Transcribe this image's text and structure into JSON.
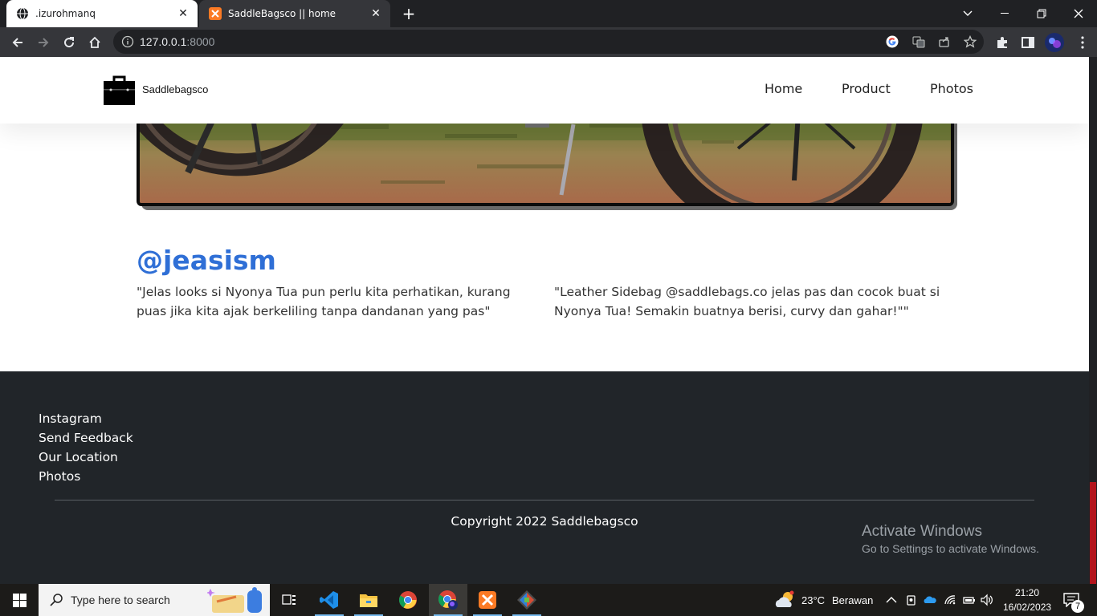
{
  "browser": {
    "tabs": [
      {
        "title": ".izurohmanq",
        "active": false
      },
      {
        "title": "SaddleBagsco || home",
        "active": true
      }
    ],
    "url_host": "127.0.0.1",
    "url_port": ":8000"
  },
  "site": {
    "brand": "Saddlebagsco",
    "nav": [
      "Home",
      "Product",
      "Photos"
    ],
    "testimonial": {
      "handle": "@jeasism",
      "quote_left": "\"Jelas looks si Nyonya Tua pun perlu kita perhatikan, kurang puas jika kita ajak berkeliling tanpa dandanan yang pas\"",
      "quote_right": "\"Leather Sidebag @saddlebags.co jelas pas dan cocok buat si Nyonya Tua! Semakin buatnya berisi, curvy dan gahar!\"\""
    },
    "footer": {
      "links": [
        "Instagram",
        "Send Feedback",
        "Our Location",
        "Photos"
      ],
      "copyright": "Copyright 2022 Saddlebagsco"
    }
  },
  "watermark": {
    "title": "Activate Windows",
    "subtitle": "Go to Settings to activate Windows."
  },
  "taskbar": {
    "search_placeholder": "Type here to search",
    "weather_temp": "23°C",
    "weather_desc": "Berawan",
    "time": "21:20",
    "date": "16/02/2023",
    "notification_count": "7"
  },
  "colors": {
    "accent_handle": "#2f6fd6",
    "footer_bg": "#212529",
    "chrome_dark": "#202124"
  }
}
